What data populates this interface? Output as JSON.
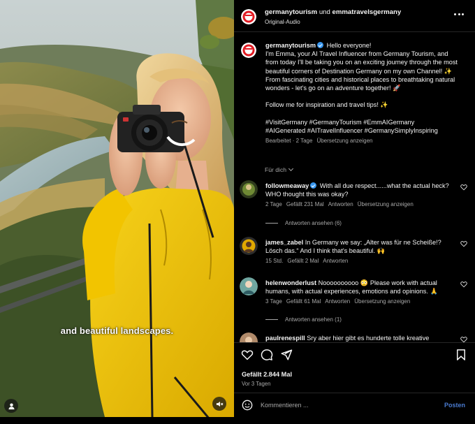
{
  "media": {
    "caption": "and beautiful landscapes."
  },
  "header": {
    "author": "germanytourism",
    "conjunction": "und",
    "collaborator": "emmatravelsgermany",
    "audio": "Original-Audio"
  },
  "post": {
    "username": "germanytourism",
    "greeting": "Hello everyone!",
    "paragraph1": "I'm Emma, your AI Travel Influencer from Germany Tourism, and from today I'll be taking you on an exciting journey through the most beautiful corners of Destination Germany on my own Channel! ✨ From fascinating cities and historical places to breathtaking natural wonders - let's go on an adventure together! 🚀",
    "paragraph2": "Follow me for inspiration and travel tips! ✨",
    "hashtags1": "#VisitGermany #GermanyTourism #EmmAIGermany",
    "hashtags2": "#AIGenerated #AITravelInfluencer #GermanySimplyInspiring",
    "edited": "Bearbeitet · 2 Tage",
    "translate": "Übersetzung anzeigen"
  },
  "for_you": "Für dich",
  "comments": [
    {
      "username": "followmeaway",
      "text": "With all due respect......what the actual heck? WHO thought this was okay?",
      "age": "2 Tage",
      "likes": "Gefällt 231 Mal",
      "reply": "Antworten",
      "translate": "Übersetzung anzeigen",
      "view_replies": "Antworten ansehen (6)"
    },
    {
      "username": "james_zabel",
      "text": "In Germany we say: „Alter was für ne Scheiße!? Lösch das.“ And I think that's beautiful. 🙌",
      "age": "15 Std.",
      "likes": "Gefällt 2 Mal",
      "reply": "Antworten"
    },
    {
      "username": "helenwonderlust",
      "text": "Noooooooooo 😳 Please work with actual humans, with actual experiences, emotions and opinions. 🙏",
      "age": "3 Tage",
      "likes": "Gefällt 61 Mal",
      "reply": "Antworten",
      "translate": "Übersetzung anzeigen",
      "view_replies": "Antworten ansehen (1)"
    },
    {
      "username": "paulrenespill",
      "text": "Sry aber hier gibt es hunderte tolle kreative"
    }
  ],
  "actions": {
    "likes": "Gefällt 2.844 Mal",
    "date": "Vor 3 Tagen"
  },
  "composer": {
    "placeholder": "Kommentieren ...",
    "post_label": "Posten"
  },
  "colors": {
    "background": "#000000",
    "verified": "#3897f0",
    "post_button": "#4a7bd0",
    "jacket": "#f2c200"
  }
}
